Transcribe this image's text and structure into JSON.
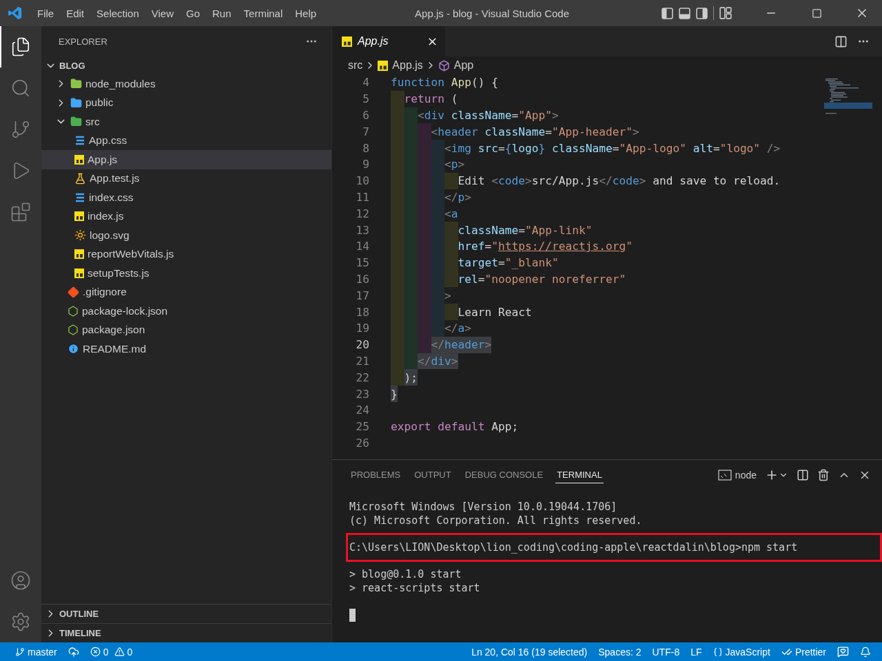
{
  "title_bar": {
    "menu": [
      "File",
      "Edit",
      "Selection",
      "View",
      "Go",
      "Run",
      "Terminal",
      "Help"
    ],
    "title": "App.js - blog - Visual Studio Code"
  },
  "activity_bar": {
    "top": [
      {
        "kind": "files",
        "selected": true
      },
      {
        "kind": "search",
        "selected": false
      },
      {
        "kind": "source-control",
        "selected": false
      },
      {
        "kind": "run",
        "selected": false
      },
      {
        "kind": "extensions",
        "selected": false
      }
    ],
    "bottom": [
      {
        "kind": "account"
      },
      {
        "kind": "settings"
      }
    ]
  },
  "explorer": {
    "title": "EXPLORER",
    "root": {
      "label": "BLOG",
      "expanded": true
    },
    "tree": [
      {
        "label": "node_modules",
        "kind": "folder-node",
        "expanded": false,
        "selected": false
      },
      {
        "label": "public",
        "kind": "folder-public",
        "expanded": false,
        "selected": false
      },
      {
        "label": "src",
        "kind": "folder-src",
        "expanded": true,
        "selected": false,
        "children": [
          {
            "label": "App.css",
            "kind": "css",
            "selected": false
          },
          {
            "label": "App.js",
            "kind": "js",
            "selected": true
          },
          {
            "label": "App.test.js",
            "kind": "test",
            "selected": false
          },
          {
            "label": "index.css",
            "kind": "css",
            "selected": false
          },
          {
            "label": "index.js",
            "kind": "js",
            "selected": false
          },
          {
            "label": "logo.svg",
            "kind": "svg",
            "selected": false
          },
          {
            "label": "reportWebVitals.js",
            "kind": "js",
            "selected": false
          },
          {
            "label": "setupTests.js",
            "kind": "js",
            "selected": false
          }
        ]
      },
      {
        "label": ".gitignore",
        "kind": "git",
        "selected": false
      },
      {
        "label": "package-lock.json",
        "kind": "json",
        "selected": false
      },
      {
        "label": "package.json",
        "kind": "json",
        "selected": false
      },
      {
        "label": "README.md",
        "kind": "info",
        "selected": false
      }
    ],
    "sections": [
      {
        "label": "OUTLINE",
        "expanded": false
      },
      {
        "label": "TIMELINE",
        "expanded": false
      }
    ]
  },
  "editor": {
    "tab": {
      "label": "App.js",
      "kind": "js"
    },
    "breadcrumbs": [
      {
        "label": "src",
        "kind": "folder"
      },
      {
        "label": "App.js",
        "kind": "js"
      },
      {
        "label": "App",
        "kind": "symbol"
      }
    ],
    "lines": [
      {
        "n": "4",
        "tokens": [
          {
            "t": "function",
            "kind": "decl"
          },
          {
            "t": " App",
            "kind": "fn"
          },
          {
            "t": "() {",
            "kind": "plain"
          }
        ]
      },
      {
        "n": "5",
        "tokens": [
          {
            "t": "  return",
            "kind": "kw"
          },
          {
            "t": " (",
            "kind": "plain"
          }
        ]
      },
      {
        "n": "6",
        "tokens": [
          {
            "t": "    <",
            "kind": "br"
          },
          {
            "t": "div",
            "kind": "tag"
          },
          {
            "t": " className",
            "kind": "attr"
          },
          {
            "t": "=",
            "kind": "plain"
          },
          {
            "t": "\"App\"",
            "kind": "str"
          },
          {
            "t": ">",
            "kind": "br"
          }
        ]
      },
      {
        "n": "7",
        "tokens": [
          {
            "t": "      <",
            "kind": "br"
          },
          {
            "t": "header",
            "kind": "tag"
          },
          {
            "t": " className",
            "kind": "attr"
          },
          {
            "t": "=",
            "kind": "plain"
          },
          {
            "t": "\"App-header\"",
            "kind": "str"
          },
          {
            "t": ">",
            "kind": "br"
          }
        ]
      },
      {
        "n": "8",
        "tokens": [
          {
            "t": "        <",
            "kind": "br"
          },
          {
            "t": "img",
            "kind": "tag"
          },
          {
            "t": " src",
            "kind": "attr"
          },
          {
            "t": "=",
            "kind": "plain"
          },
          {
            "t": "{",
            "kind": "decl"
          },
          {
            "t": "logo",
            "kind": "attr"
          },
          {
            "t": "}",
            "kind": "decl"
          },
          {
            "t": " className",
            "kind": "attr"
          },
          {
            "t": "=",
            "kind": "plain"
          },
          {
            "t": "\"App-logo\"",
            "kind": "str"
          },
          {
            "t": " alt",
            "kind": "attr"
          },
          {
            "t": "=",
            "kind": "plain"
          },
          {
            "t": "\"logo\"",
            "kind": "str"
          },
          {
            "t": " />",
            "kind": "br"
          }
        ]
      },
      {
        "n": "9",
        "tokens": [
          {
            "t": "        <",
            "kind": "br"
          },
          {
            "t": "p",
            "kind": "tag"
          },
          {
            "t": ">",
            "kind": "br"
          }
        ]
      },
      {
        "n": "10",
        "tokens": [
          {
            "t": "          Edit ",
            "kind": "plain"
          },
          {
            "t": "<",
            "kind": "br"
          },
          {
            "t": "code",
            "kind": "tag"
          },
          {
            "t": ">",
            "kind": "br"
          },
          {
            "t": "src/App.js",
            "kind": "plain"
          },
          {
            "t": "</",
            "kind": "br"
          },
          {
            "t": "code",
            "kind": "tag"
          },
          {
            "t": ">",
            "kind": "br"
          },
          {
            "t": " and save to reload.",
            "kind": "plain"
          }
        ]
      },
      {
        "n": "11",
        "tokens": [
          {
            "t": "        </",
            "kind": "br"
          },
          {
            "t": "p",
            "kind": "tag"
          },
          {
            "t": ">",
            "kind": "br"
          }
        ]
      },
      {
        "n": "12",
        "tokens": [
          {
            "t": "        <",
            "kind": "br"
          },
          {
            "t": "a",
            "kind": "tag"
          }
        ]
      },
      {
        "n": "13",
        "tokens": [
          {
            "t": "          className",
            "kind": "attr"
          },
          {
            "t": "=",
            "kind": "plain"
          },
          {
            "t": "\"App-link\"",
            "kind": "str"
          }
        ]
      },
      {
        "n": "14",
        "tokens": [
          {
            "t": "          href",
            "kind": "attr"
          },
          {
            "t": "=",
            "kind": "plain"
          },
          {
            "t": "\"",
            "kind": "str"
          },
          {
            "t": "https://reactjs.org",
            "kind": "link"
          },
          {
            "t": "\"",
            "kind": "str"
          }
        ]
      },
      {
        "n": "15",
        "tokens": [
          {
            "t": "          target",
            "kind": "attr"
          },
          {
            "t": "=",
            "kind": "plain"
          },
          {
            "t": "\"_blank\"",
            "kind": "str"
          }
        ]
      },
      {
        "n": "16",
        "tokens": [
          {
            "t": "          rel",
            "kind": "attr"
          },
          {
            "t": "=",
            "kind": "plain"
          },
          {
            "t": "\"noopener noreferrer\"",
            "kind": "str"
          }
        ]
      },
      {
        "n": "17",
        "tokens": [
          {
            "t": "        >",
            "kind": "br"
          }
        ]
      },
      {
        "n": "18",
        "tokens": [
          {
            "t": "          Learn React",
            "kind": "plain"
          }
        ]
      },
      {
        "n": "19",
        "tokens": [
          {
            "t": "        </",
            "kind": "br"
          },
          {
            "t": "a",
            "kind": "tag"
          },
          {
            "t": ">",
            "kind": "br"
          }
        ]
      },
      {
        "n": "20",
        "current": true,
        "selected": true,
        "tokens": [
          {
            "t": "      </",
            "kind": "br"
          },
          {
            "t": "header",
            "kind": "tag"
          },
          {
            "t": ">",
            "kind": "br"
          }
        ]
      },
      {
        "n": "21",
        "selected": true,
        "tokens": [
          {
            "t": "    </",
            "kind": "br"
          },
          {
            "t": "div",
            "kind": "tag"
          },
          {
            "t": ">",
            "kind": "br"
          }
        ]
      },
      {
        "n": "22",
        "selected": true,
        "tokens": [
          {
            "t": "  );",
            "kind": "plain"
          }
        ]
      },
      {
        "n": "23",
        "selected": true,
        "tokens": [
          {
            "t": "}",
            "kind": "plain"
          }
        ]
      },
      {
        "n": "24"
      },
      {
        "n": "25",
        "tokens": [
          {
            "t": "export",
            "kind": "kw"
          },
          {
            "t": " default",
            "kind": "kw"
          },
          {
            "t": " App;",
            "kind": "plain"
          }
        ]
      },
      {
        "n": "26"
      }
    ]
  },
  "panel": {
    "tabs": [
      {
        "label": "PROBLEMS",
        "selected": false
      },
      {
        "label": "OUTPUT",
        "selected": false
      },
      {
        "label": "DEBUG CONSOLE",
        "selected": false
      },
      {
        "label": "TERMINAL",
        "selected": true
      }
    ],
    "profile": "node",
    "terminal": [
      {
        "text": "Microsoft Windows [Version 10.0.19044.1706]"
      },
      {
        "text": "(c) Microsoft Corporation. All rights reserved."
      },
      {
        "text": "C:\\Users\\LION\\Desktop\\lion_coding\\coding-apple\\reactdalin\\blog>npm start",
        "highlighted": true
      },
      {
        "text": "> blog@0.1.0 start"
      },
      {
        "text": "> react-scripts start"
      }
    ]
  },
  "status_bar": {
    "left": [
      {
        "kind": "branch",
        "text": "master"
      },
      {
        "kind": "sync"
      },
      {
        "kind": "errors",
        "text": "0"
      },
      {
        "kind": "warnings",
        "text": "0"
      }
    ],
    "right": [
      {
        "kind": "text",
        "text": "Ln 20, Col 16 (19 selected)"
      },
      {
        "kind": "text",
        "text": "Spaces: 2"
      },
      {
        "kind": "text",
        "text": "UTF-8"
      },
      {
        "kind": "text",
        "text": "LF"
      },
      {
        "kind": "language",
        "text": "JavaScript"
      },
      {
        "kind": "prettier",
        "text": "Prettier"
      },
      {
        "kind": "feedback"
      },
      {
        "kind": "bell"
      }
    ]
  }
}
